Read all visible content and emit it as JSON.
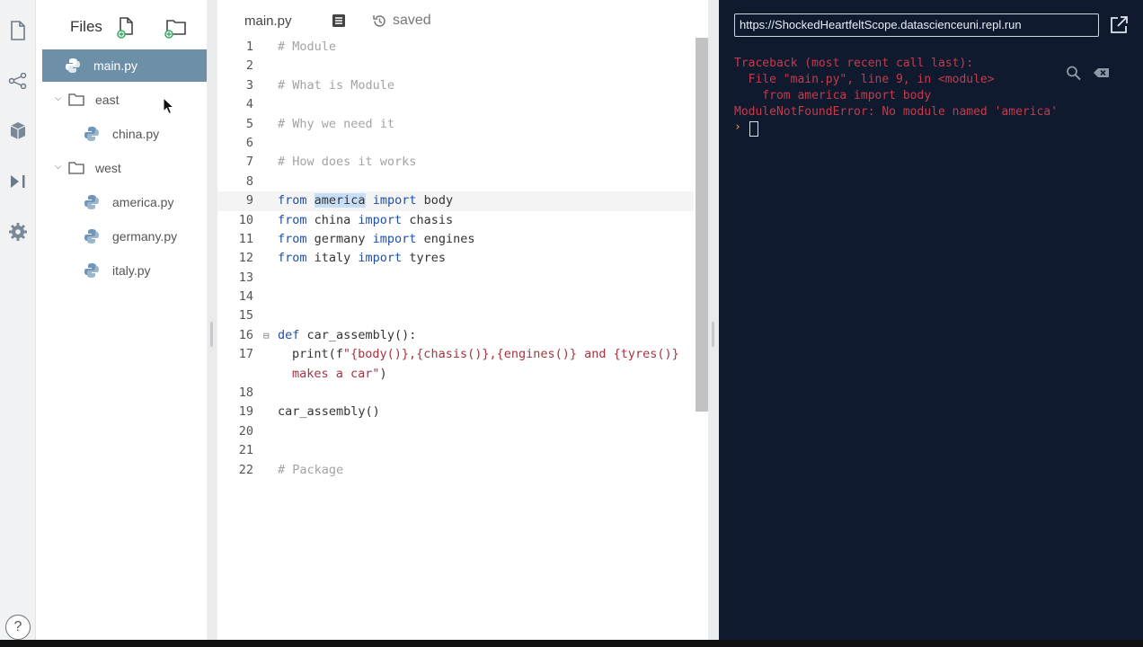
{
  "files_panel": {
    "title": "Files",
    "items": [
      {
        "label": "main.py"
      },
      {
        "label": "east"
      },
      {
        "label": "china.py"
      },
      {
        "label": "west"
      },
      {
        "label": "america.py"
      },
      {
        "label": "germany.py"
      },
      {
        "label": "italy.py"
      }
    ]
  },
  "editor": {
    "tab_label": "main.py",
    "status": "saved",
    "lines": [
      {
        "n": "1"
      },
      {
        "n": "2"
      },
      {
        "n": "3"
      },
      {
        "n": "4"
      },
      {
        "n": "5"
      },
      {
        "n": "6"
      },
      {
        "n": "7"
      },
      {
        "n": "8"
      },
      {
        "n": "9"
      },
      {
        "n": "10"
      },
      {
        "n": "11"
      },
      {
        "n": "12"
      },
      {
        "n": "13"
      },
      {
        "n": "14"
      },
      {
        "n": "15"
      },
      {
        "n": "16"
      },
      {
        "n": "17"
      },
      {
        "n": "",
        "wrap": true
      },
      {
        "n": "18"
      },
      {
        "n": "19"
      },
      {
        "n": "20"
      },
      {
        "n": "21"
      },
      {
        "n": "22"
      }
    ],
    "code": {
      "c1": "# Module",
      "c3": "# What is Module",
      "c5": "# Why we need it",
      "c7": "# How does it works",
      "kw_from": "from",
      "kw_import": "import",
      "kw_def": "def",
      "l9_mod": "america",
      "l9_name": " body",
      "l10_mod": " china ",
      "l10_name": " chasis",
      "l11_mod": " germany ",
      "l11_name": " engines",
      "l12_mod": " italy ",
      "l12_name": " tyres",
      "l16_rest": " car_assembly():",
      "l17_a": "print(f",
      "l17_str": "\"{body()},{chasis()},{engines()} and {tyres()}",
      "l17b_str": "makes a car\"",
      "l17b_end": ")",
      "l19": "car_assembly()",
      "c22": "# Package"
    }
  },
  "console": {
    "url": "https://ShockedHeartfeltScope.datascienceuni.repl.run",
    "output": [
      "Traceback (most recent call last):",
      "  File \"main.py\", line 9, in <module>",
      "    from america import body",
      "ModuleNotFoundError: No module named 'america'"
    ],
    "prompt": "›"
  },
  "help_label": "?",
  "colors": {
    "active_file": "#6e8fa8",
    "console_bg": "#0f1a2e",
    "error_text": "#c63a4b",
    "keyword": "#1f4fa8",
    "accent": "#3fa96b"
  }
}
